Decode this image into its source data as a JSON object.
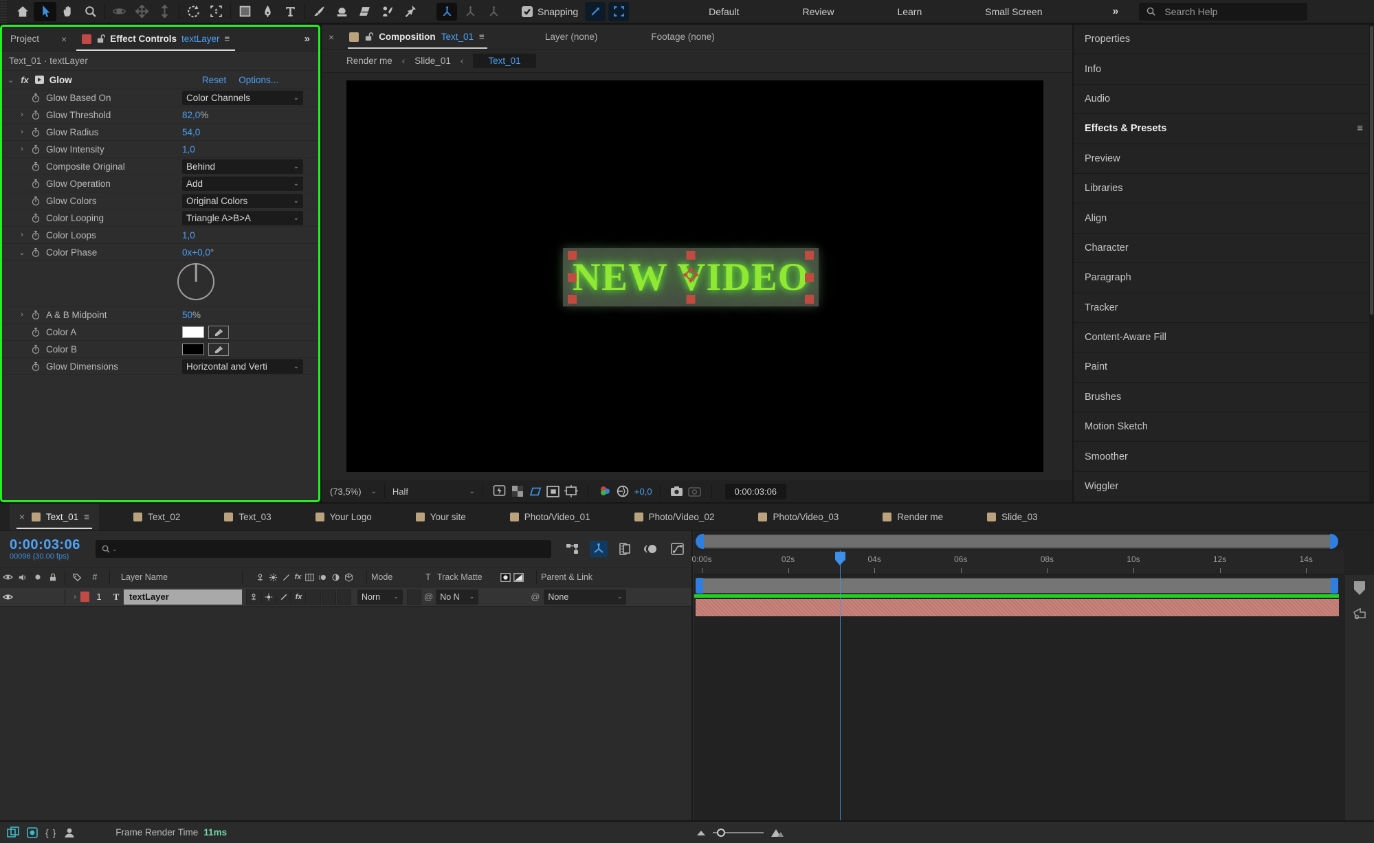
{
  "icons_map": {
    "close": "×",
    "menu": "≡",
    "overflow": "»",
    "chev_down": "⌄",
    "chev_left": "‹",
    "at": "@",
    "fx": "fx",
    "braces": "{ }",
    "hash": "#"
  },
  "colors": {
    "accent_blue": "#4ba0f5",
    "panel_highlight_green": "#24ef24",
    "tab_square_tan": "#b9a27c",
    "label_red": "#c34a44",
    "layer_bar_salmon": "#c97f78",
    "cache_green": "#21d321",
    "glow_text_green": "#90e832",
    "timecode_blue": "#4fa4f7",
    "render_time_green": "#6fd7a3"
  },
  "toolbar": {
    "tools": [
      "home",
      "selection",
      "hand",
      "zoom",
      "orbit-camera",
      "pan-camera",
      "dolly-camera",
      "rotation",
      "camera-frame",
      "rectangle",
      "pen",
      "type",
      "brush",
      "clone-stamp",
      "eraser",
      "roto-brush",
      "puppet-pin"
    ],
    "active_tool": "selection",
    "axis_modes": [
      "local-axis",
      "world-axis",
      "view-axis"
    ],
    "active_axis": "local-axis",
    "snapping_label": "Snapping",
    "snapping_checked": true,
    "workspaces": [
      "Default",
      "Review",
      "Learn",
      "Small Screen"
    ],
    "search_placeholder": "Search Help"
  },
  "effect_controls": {
    "inactive_tab": "Project",
    "title": "Effect Controls",
    "target": "textLayer",
    "subtitle": "Text_01 · textLayer",
    "effect_name": "Glow",
    "reset_label": "Reset",
    "options_label": "Options...",
    "rows": [
      {
        "label": "Glow Based On",
        "type": "dropdown",
        "value": "Color Channels"
      },
      {
        "label": "Glow Threshold",
        "type": "value",
        "value": "82,0",
        "suffix": "%",
        "expander": "closed"
      },
      {
        "label": "Glow Radius",
        "type": "value",
        "value": "54,0",
        "suffix": "",
        "expander": "closed"
      },
      {
        "label": "Glow Intensity",
        "type": "value",
        "value": "1,0",
        "suffix": "",
        "expander": "closed"
      },
      {
        "label": "Composite Original",
        "type": "dropdown",
        "value": "Behind"
      },
      {
        "label": "Glow Operation",
        "type": "dropdown",
        "value": "Add"
      },
      {
        "label": "Glow Colors",
        "type": "dropdown",
        "value": "Original Colors"
      },
      {
        "label": "Color Looping",
        "type": "dropdown",
        "value": "Triangle A>B>A"
      },
      {
        "label": "Color Loops",
        "type": "value",
        "value": "1,0",
        "suffix": "",
        "expander": "closed"
      },
      {
        "label": "Color Phase",
        "type": "value",
        "value": "0x+0,0",
        "suffix": "°",
        "expander": "open",
        "dial": true
      },
      {
        "label": "A & B Midpoint",
        "type": "value",
        "value": "50",
        "suffix": "%",
        "expander": "closed"
      },
      {
        "label": "Color A",
        "type": "swatch",
        "swatch": "#ffffff"
      },
      {
        "label": "Color B",
        "type": "swatch",
        "swatch": "#000000"
      },
      {
        "label": "Glow Dimensions",
        "type": "dropdown",
        "value": "Horizontal and Verti"
      }
    ]
  },
  "composition": {
    "title": "Composition",
    "comp_name": "Text_01",
    "other_tabs": [
      "Layer (none)",
      "Footage (none)"
    ],
    "breadcrumbs": [
      "Render me",
      "Slide_01",
      "Text_01"
    ],
    "canvas_text": "NEW VIDEO",
    "zoom_level": "(73,5%)",
    "resolution": "Half",
    "exposure": "+0,0",
    "timecode": "0:00:03:06"
  },
  "sidebar": {
    "active": "Effects & Presets",
    "panels": [
      "Properties",
      "Info",
      "Audio",
      "Effects & Presets",
      "Preview",
      "Libraries",
      "Align",
      "Character",
      "Paragraph",
      "Tracker",
      "Content-Aware Fill",
      "Paint",
      "Brushes",
      "Motion Sketch",
      "Smoother",
      "Wiggler"
    ]
  },
  "timeline": {
    "tabs": [
      "Text_01",
      "Text_02",
      "Text_03",
      "Your Logo",
      "Your site",
      "Photo/Video_01",
      "Photo/Video_02",
      "Photo/Video_03",
      "Render me",
      "Slide_03"
    ],
    "active_tab": "Text_01",
    "timecode": "0:00:03:06",
    "frame_info": "00096 (30.00 fps)",
    "columns": {
      "index": "#",
      "layer_name": "Layer Name",
      "mode": "Mode",
      "matte_toggle": "T",
      "track_matte": "Track Matte",
      "parent": "Parent & Link"
    },
    "layer": {
      "index": "1",
      "name": "textLayer",
      "mode": "Norn",
      "track_matte": "No N",
      "parent": "None"
    },
    "ruler_ticks": [
      "0:00s",
      "02s",
      "04s",
      "06s",
      "08s",
      "10s",
      "12s",
      "14s"
    ],
    "playhead_seconds": 3.2
  },
  "statusbar": {
    "label": "Frame Render Time",
    "value": "11ms"
  }
}
